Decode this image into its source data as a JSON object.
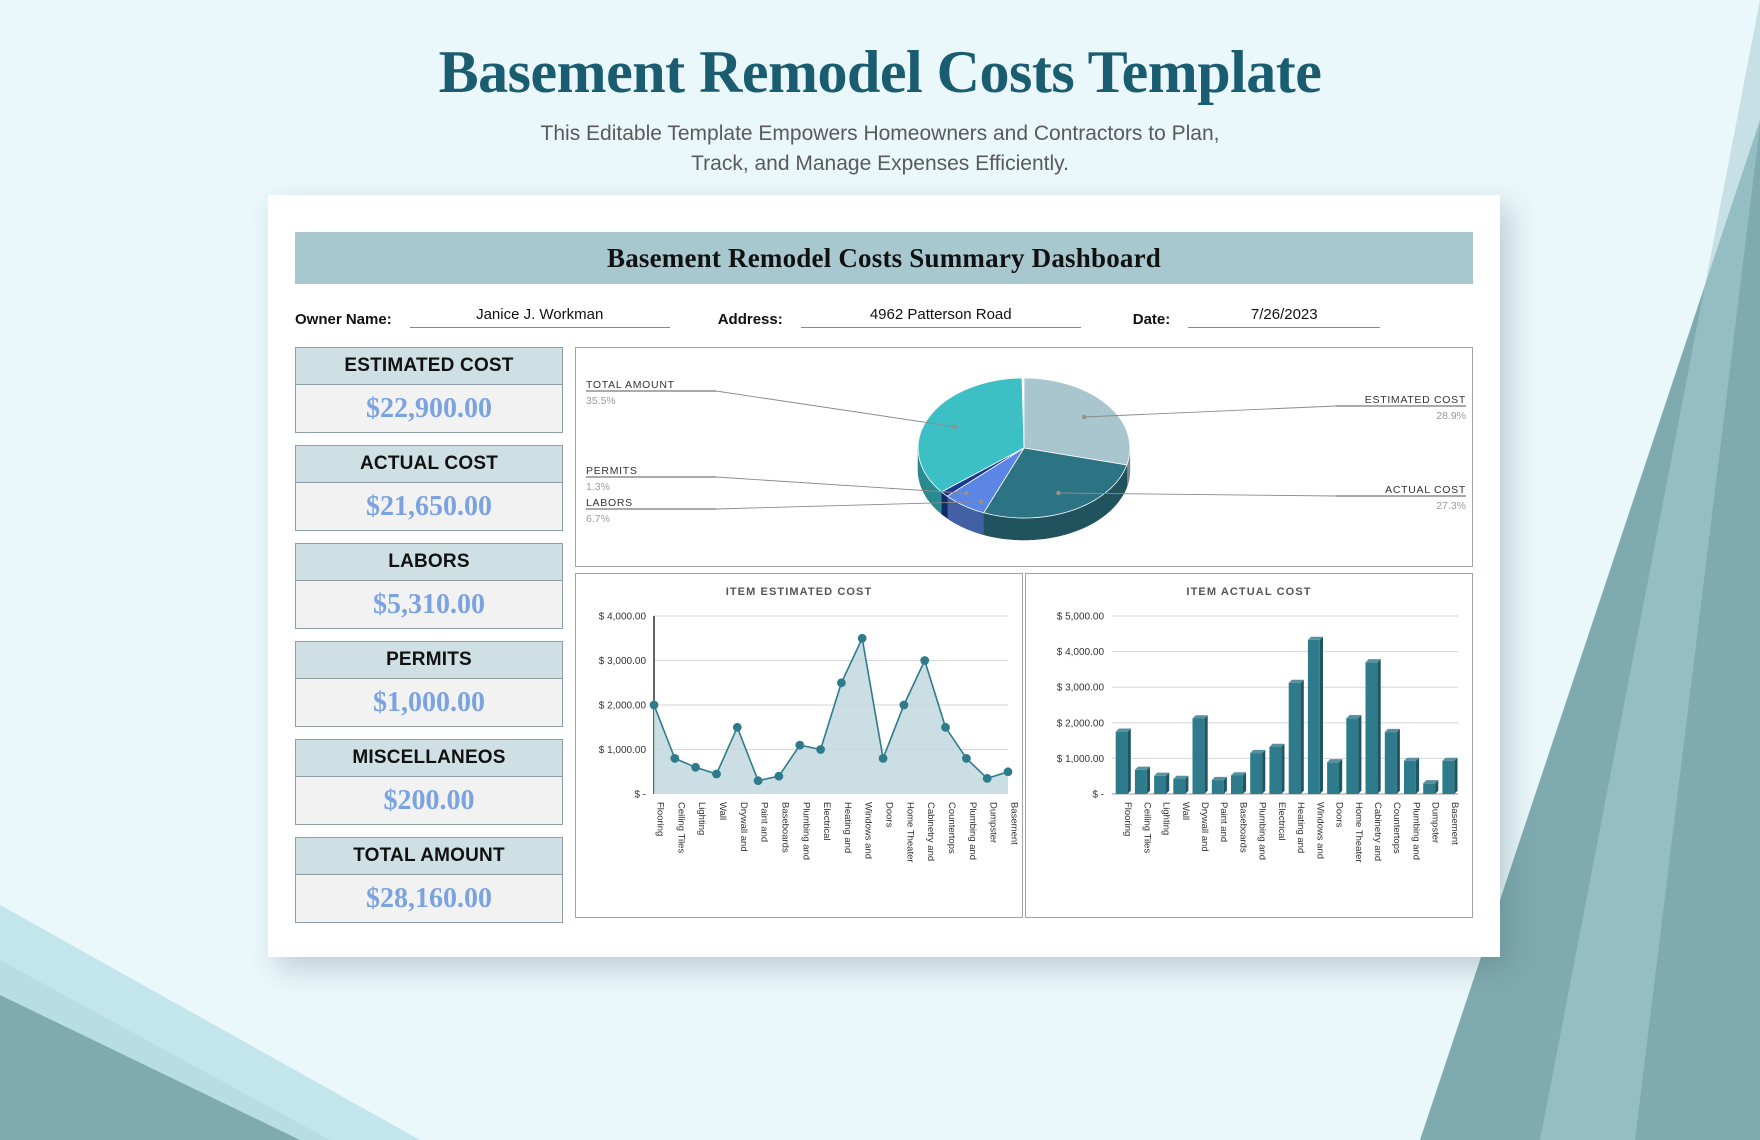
{
  "page": {
    "main_title": "Basement Remodel Costs Template",
    "subtitle_line1": "This Editable Template Empowers Homeowners and Contractors to Plan,",
    "subtitle_line2": "Track, and Manage Expenses Efficiently."
  },
  "dashboard": {
    "header": "Basement Remodel Costs Summary Dashboard",
    "info": {
      "owner_label": "Owner Name:",
      "owner_value": "Janice J. Workman",
      "address_label": "Address:",
      "address_value": "4962 Patterson Road",
      "date_label": "Date:",
      "date_value": "7/26/2023"
    },
    "cards": [
      {
        "label": "ESTIMATED COST",
        "value": "$22,900.00"
      },
      {
        "label": "ACTUAL COST",
        "value": "$21,650.00"
      },
      {
        "label": "LABORS",
        "value": "$5,310.00"
      },
      {
        "label": "PERMITS",
        "value": "$1,000.00"
      },
      {
        "label": "MISCELLANEOS",
        "value": "$200.00"
      },
      {
        "label": "TOTAL AMOUNT",
        "value": "$28,160.00"
      }
    ]
  },
  "colors": {
    "header_band": "#a8c8d0",
    "card_head": "#cfe0e5",
    "card_value": "#7aa3e0",
    "title": "#1a5c70",
    "pie_estimated": "#a9c5ce",
    "pie_actual": "#2c7383",
    "pie_labors": "#5b86e5",
    "pie_permits": "#1b3a8f",
    "pie_total": "#3cc0c6",
    "series_teal": "#2e7b8c",
    "area_fill": "#c2d8de"
  },
  "chart_data": [
    {
      "type": "pie",
      "title": "",
      "labels": [
        "ESTIMATED COST",
        "ACTUAL COST",
        "LABORS",
        "PERMITS",
        "TOTAL AMOUNT"
      ],
      "percents": [
        28.9,
        27.3,
        6.7,
        1.3,
        35.5
      ],
      "pct_strings": [
        "28.9%",
        "27.3%",
        "6.7%",
        "1.3%",
        "35.5%"
      ],
      "values": [
        22900,
        21650,
        5310,
        1000,
        28160
      ],
      "colors": [
        "#a9c5ce",
        "#2c7383",
        "#5b86e5",
        "#1b3a8f",
        "#3cc0c6"
      ],
      "legend": "callout-labels"
    },
    {
      "type": "area",
      "title": "ITEM ESTIMATED COST",
      "categories": [
        "Flooring",
        "Ceiling Tiles",
        "Lighting",
        "Wall",
        "Drywall and",
        "Paint and",
        "Baseboards",
        "Plumbing and",
        "Electrical",
        "Heating and",
        "Windows and",
        "Doors",
        "Home Theater",
        "Cabinetry and",
        "Countertops",
        "Plumbing and",
        "Dumpster",
        "Basement"
      ],
      "values": [
        2000,
        800,
        600,
        450,
        1500,
        300,
        400,
        1100,
        1000,
        2500,
        3500,
        800,
        2000,
        3000,
        1500,
        800,
        350,
        500
      ],
      "ytick_labels": [
        "$ -",
        "$ 1,000.00",
        "$ 2,000.00",
        "$ 3,000.00",
        "$ 4,000.00"
      ],
      "yticks": [
        0,
        1000,
        2000,
        3000,
        4000
      ],
      "ylim": [
        0,
        4000
      ],
      "xlabel": "",
      "ylabel": "",
      "grid": true
    },
    {
      "type": "bar",
      "title": "ITEM ACTUAL COST",
      "categories": [
        "Flooring",
        "Ceiling Tiles",
        "Lighting",
        "Wall",
        "Drywall and",
        "Paint and",
        "Baseboards",
        "Plumbing and",
        "Electrical",
        "Heating and",
        "Windows and",
        "Doors",
        "Home Theater",
        "Cabinetry and",
        "Countertops",
        "Plumbing and",
        "Dumpster",
        "Basement"
      ],
      "values": [
        1750,
        680,
        510,
        420,
        2120,
        390,
        520,
        1150,
        1320,
        3120,
        4330,
        890,
        2130,
        3700,
        1740,
        930,
        300,
        930
      ],
      "ytick_labels": [
        "$ -",
        "$ 1,000.00",
        "$ 2,000.00",
        "$ 3,000.00",
        "$ 4,000.00",
        "$ 5,000.00"
      ],
      "yticks": [
        0,
        1000,
        2000,
        3000,
        4000,
        5000
      ],
      "ylim": [
        0,
        5000
      ],
      "xlabel": "",
      "ylabel": "",
      "grid": true
    }
  ]
}
